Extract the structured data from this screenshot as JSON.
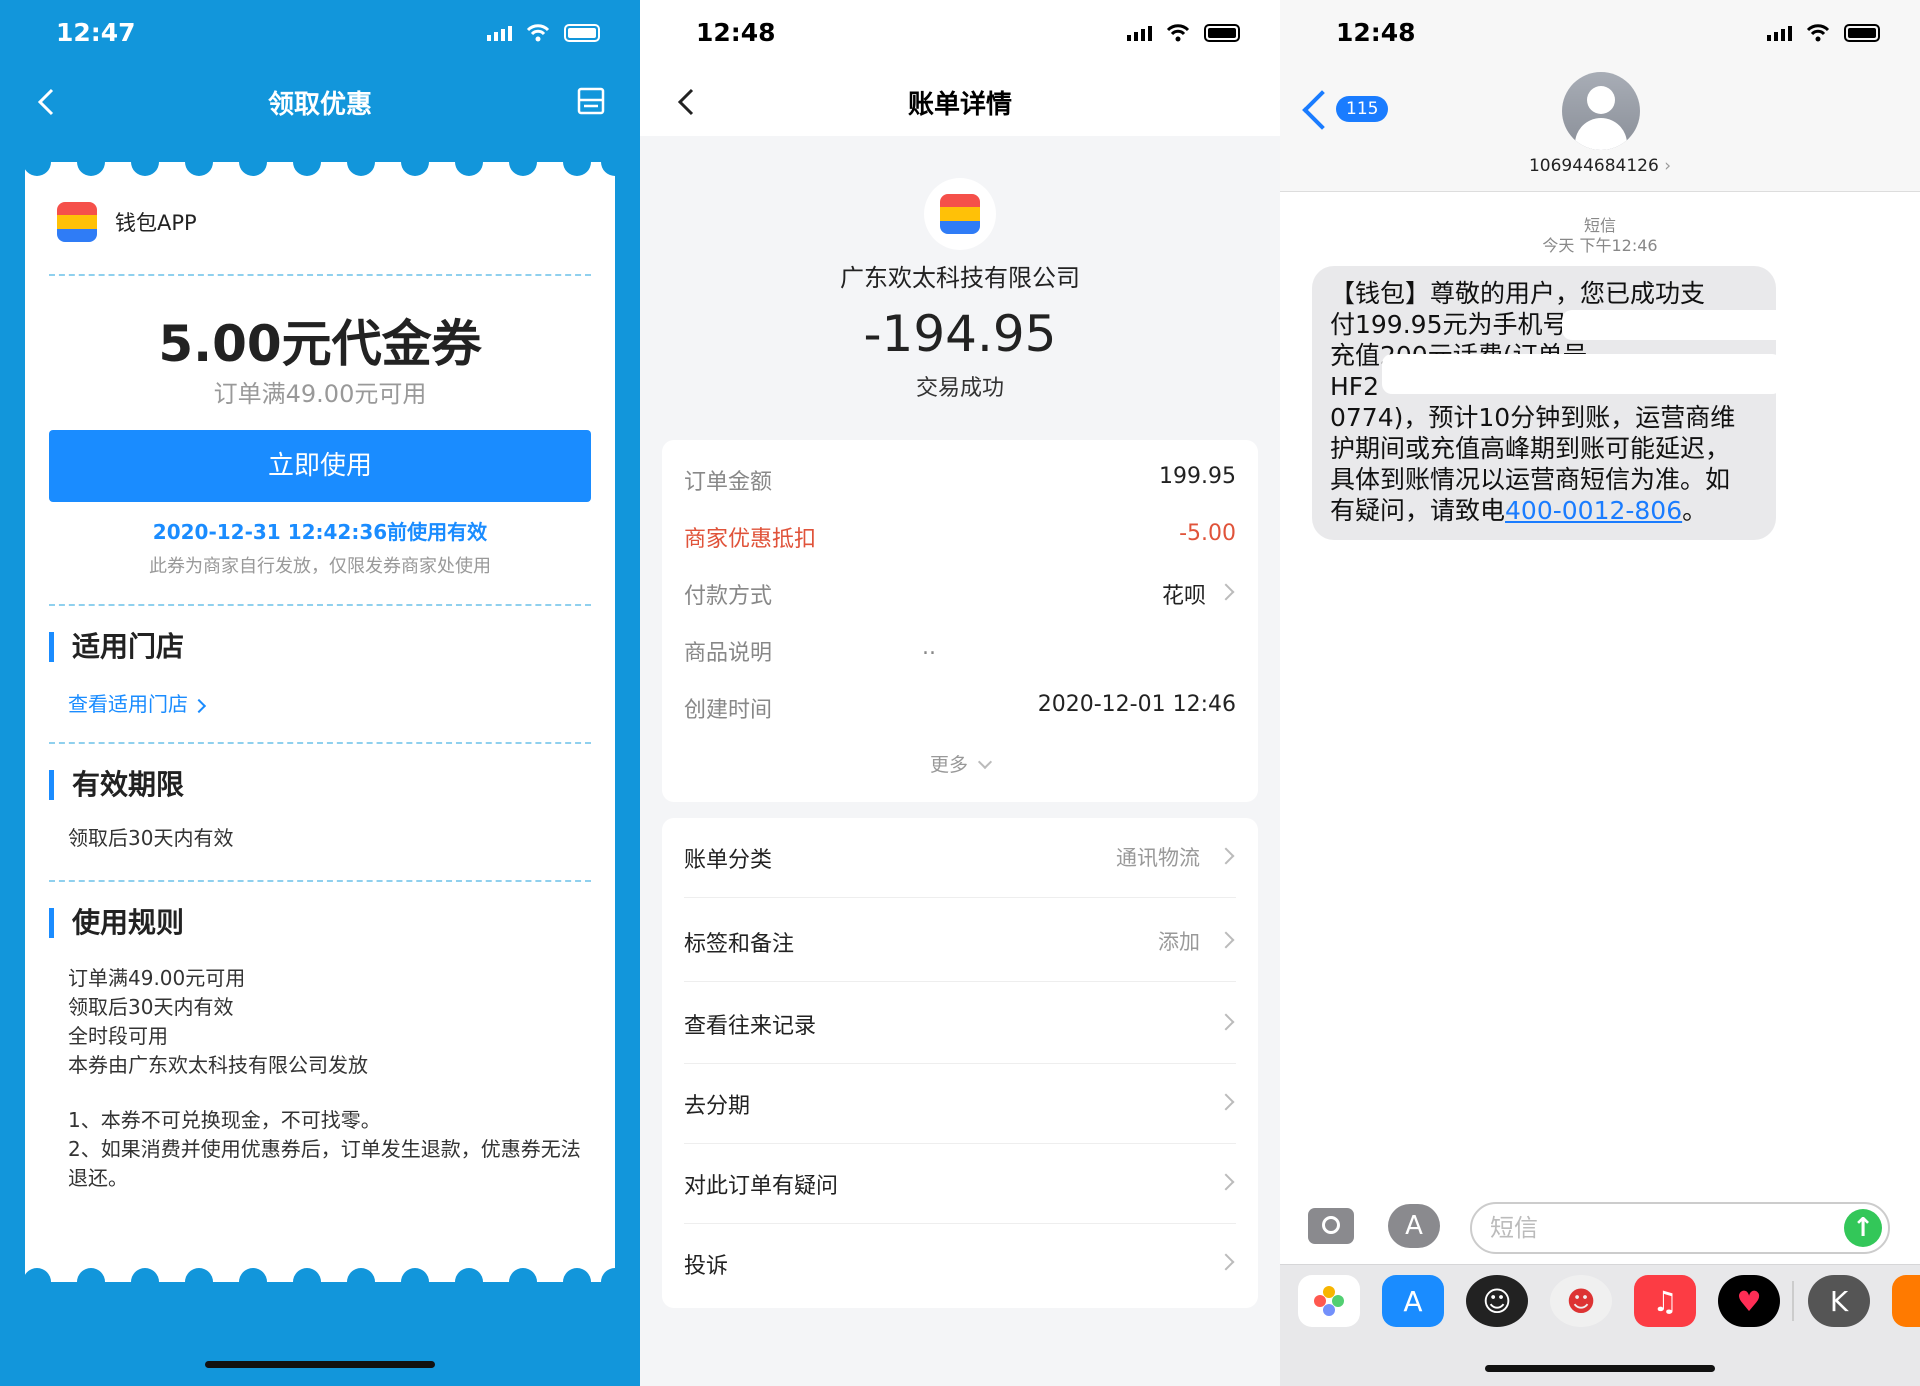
{
  "colors": {
    "alipay_blue": "#1296db",
    "button_blue": "#1a8cff",
    "discount_red": "#e0533a",
    "ios_blue": "#1a7cff",
    "send_green": "#33c759"
  },
  "panel1": {
    "time": "12:47",
    "nav_title": "领取优惠",
    "brand": "钱包APP",
    "coupon_amount": "5.00元代金券",
    "coupon_condition": "订单满49.00元可用",
    "use_button": "立即使用",
    "valid_until": "2020-12-31 12:42:36前使用有效",
    "issuer_note": "此券为商家自行发放，仅限发券商家处使用",
    "stores_title": "适用门店",
    "stores_link": "查看适用门店",
    "validity_title": "有效期限",
    "validity_text": "领取后30天内有效",
    "rules_title": "使用规则",
    "rules": [
      "订单满49.00元可用",
      "领取后30天内有效",
      "全时段可用",
      "本券由广东欢太科技有限公司发放"
    ],
    "terms": [
      "1、本券不可兑换现金，不可找零。",
      "2、如果消费并使用优惠券后，订单发生退款，优惠券无法退还。"
    ]
  },
  "panel2": {
    "time": "12:48",
    "nav_title": "账单详情",
    "merchant": "广东欢太科技有限公司",
    "amount": "-194.95",
    "status": "交易成功",
    "details": [
      {
        "label": "订单金额",
        "value": "199.95"
      },
      {
        "label": "商家优惠抵扣",
        "value": "-5.00"
      },
      {
        "label": "付款方式",
        "value": "花呗"
      },
      {
        "label": "商品说明",
        "value": ".."
      },
      {
        "label": "创建时间",
        "value": "2020-12-01 12:46"
      }
    ],
    "more": "更多",
    "actions": [
      {
        "label": "账单分类",
        "value": "通讯物流"
      },
      {
        "label": "标签和备注",
        "value": "添加"
      },
      {
        "label": "查看往来记录",
        "value": ""
      },
      {
        "label": "去分期",
        "value": ""
      },
      {
        "label": "对此订单有疑问",
        "value": ""
      },
      {
        "label": "投诉",
        "value": ""
      }
    ]
  },
  "panel3": {
    "time": "12:48",
    "back_badge": "115",
    "sender": "106944684126",
    "meta_type": "短信",
    "meta_time": "今天 下午12:46",
    "message_lines": [
      "【钱包】尊敬的用户，您已成功支",
      "付199.95元为手机号",
      "充值200元话费(订单号",
      "HF2",
      "0774)，预计10分钟到账，运营商维",
      "护期间或充值高峰期到账可能延迟，",
      "具体到账情况以运营商短信为准。如",
      "有疑问，请致电"
    ],
    "phone_link": "400-0012-806",
    "message_end": "。",
    "input_placeholder": "短信",
    "send_icon": "↑"
  }
}
